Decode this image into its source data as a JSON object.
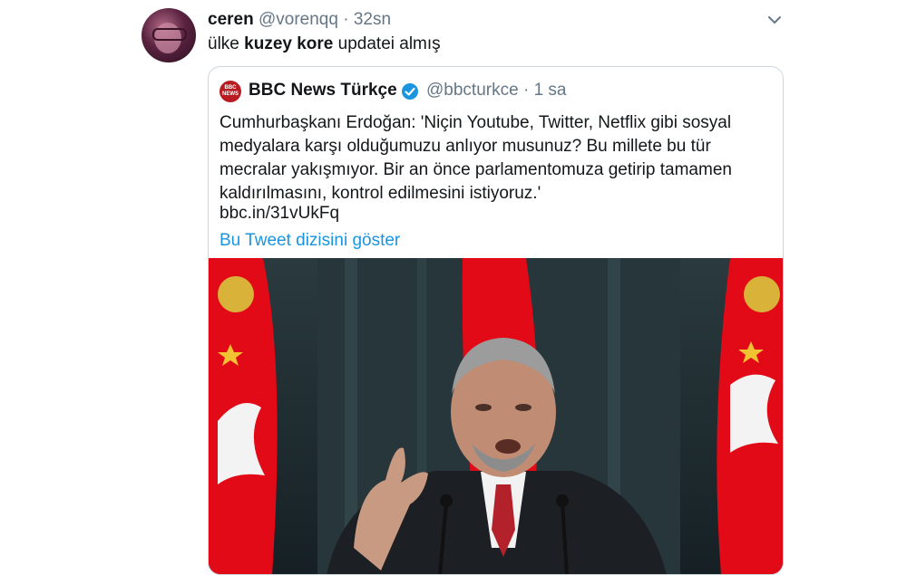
{
  "tweet": {
    "author_name": "ceren",
    "author_handle": "@vorenqq",
    "separator": "·",
    "time": "32sn",
    "text_parts": [
      "ülke ",
      "kuzey kore",
      " updatei almış"
    ],
    "icons": {
      "menu": "chevron-down-icon",
      "avatar": "avatar"
    }
  },
  "quote": {
    "author_name": "BBC News Türkçe",
    "author_handle": "@bbcturkce",
    "separator": "·",
    "time": "1 sa",
    "logo_text": [
      "BBC",
      "NEWS"
    ],
    "body": "Cumhurbaşkanı Erdoğan: 'Niçin Youtube, Twitter, Netflix gibi sosyal medyalara karşı olduğumuzu anlıyor musunuz? Bu millete bu tür mecralar yakışmıyor. Bir an önce parlamentomuza getirip tamamen kaldırılmasını, kontrol edilmesini istiyoruz.'",
    "link": "bbc.in/31vUkFq",
    "thread_link": "Bu Tweet dizisini göster",
    "icons": {
      "verified": "verified-badge-icon"
    }
  },
  "colors": {
    "accent": "#1b95e0",
    "muted": "#657786",
    "text": "#14171a",
    "border": "#ccd6dd",
    "bbc_red": "#b81c22",
    "flag_red": "#e30a17"
  }
}
